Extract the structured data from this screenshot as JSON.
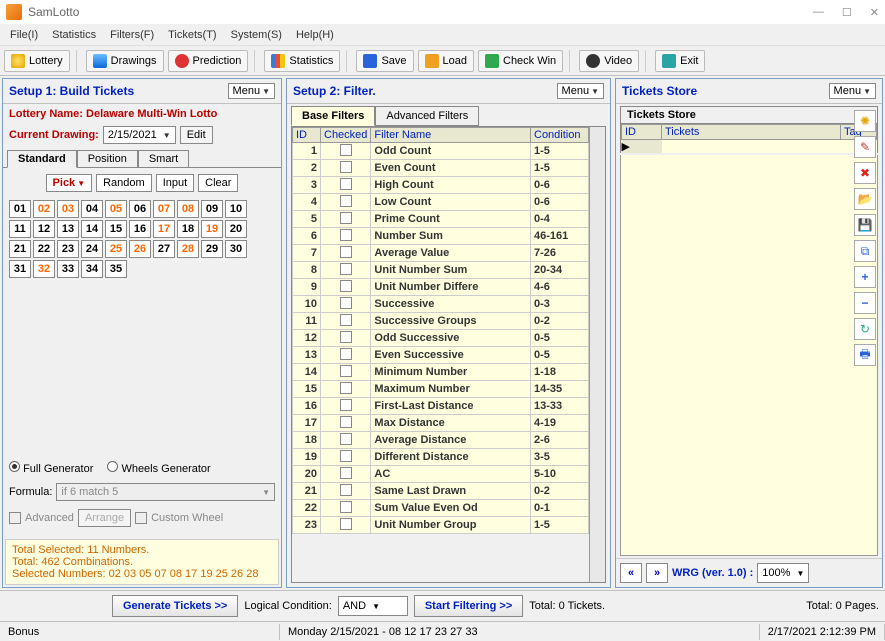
{
  "window": {
    "title": "SamLotto"
  },
  "menubar": [
    "File(I)",
    "Statistics",
    "Filters(F)",
    "Tickets(T)",
    "System(S)",
    "Help(H)"
  ],
  "toolbar": {
    "lottery": "Lottery",
    "drawings": "Drawings",
    "prediction": "Prediction",
    "statistics": "Statistics",
    "save": "Save",
    "load": "Load",
    "checkwin": "Check Win",
    "video": "Video",
    "exit": "Exit"
  },
  "p1": {
    "title": "Setup 1: Build  Tickets",
    "menu": "Menu",
    "lottery_label": "Lottery  Name: Delaware Multi-Win Lotto",
    "curdraw_label": "Current Drawing:",
    "curdraw_date": "2/15/2021",
    "edit": "Edit",
    "tabs": [
      "Standard",
      "Position",
      "Smart"
    ],
    "pick": "Pick",
    "random": "Random",
    "input": "Input",
    "clear": "Clear",
    "numbers": [
      {
        "n": "01",
        "s": false
      },
      {
        "n": "02",
        "s": true
      },
      {
        "n": "03",
        "s": true
      },
      {
        "n": "04",
        "s": false
      },
      {
        "n": "05",
        "s": true
      },
      {
        "n": "06",
        "s": false
      },
      {
        "n": "07",
        "s": true
      },
      {
        "n": "08",
        "s": true
      },
      {
        "n": "09",
        "s": false
      },
      {
        "n": "10",
        "s": false
      },
      {
        "n": "11",
        "s": false
      },
      {
        "n": "12",
        "s": false
      },
      {
        "n": "13",
        "s": false
      },
      {
        "n": "14",
        "s": false
      },
      {
        "n": "15",
        "s": false
      },
      {
        "n": "16",
        "s": false
      },
      {
        "n": "17",
        "s": true
      },
      {
        "n": "18",
        "s": false
      },
      {
        "n": "19",
        "s": true
      },
      {
        "n": "20",
        "s": false
      },
      {
        "n": "21",
        "s": false
      },
      {
        "n": "22",
        "s": false
      },
      {
        "n": "23",
        "s": false
      },
      {
        "n": "24",
        "s": false
      },
      {
        "n": "25",
        "s": true
      },
      {
        "n": "26",
        "s": true
      },
      {
        "n": "27",
        "s": false
      },
      {
        "n": "28",
        "s": true
      },
      {
        "n": "29",
        "s": false
      },
      {
        "n": "30",
        "s": false
      },
      {
        "n": "31",
        "s": false
      },
      {
        "n": "32",
        "s": true
      },
      {
        "n": "33",
        "s": false
      },
      {
        "n": "34",
        "s": false
      },
      {
        "n": "35",
        "s": false
      }
    ],
    "fullgen": "Full Generator",
    "wheelsgen": "Wheels Generator",
    "formula_label": "Formula:",
    "formula_value": "if 6 match 5",
    "advanced": "Advanced",
    "arrange": "Arrange",
    "customwheel": "Custom Wheel",
    "summary1": "Total Selected: 11 Numbers.",
    "summary2": "Total: 462 Combinations.",
    "summary3": "Selected Numbers: 02 03 05 07 08 17 19 25 26 28"
  },
  "p2": {
    "title": "Setup 2: Filter.",
    "menu": "Menu",
    "tabs": [
      "Base Filters",
      "Advanced Filters"
    ],
    "headers": {
      "id": "ID",
      "checked": "Checked",
      "filtername": "Filter Name",
      "condition": "Condition"
    },
    "rows": [
      {
        "id": "1",
        "name": "Odd Count",
        "cond": "1-5"
      },
      {
        "id": "2",
        "name": "Even Count",
        "cond": "1-5"
      },
      {
        "id": "3",
        "name": "High Count",
        "cond": "0-6"
      },
      {
        "id": "4",
        "name": "Low Count",
        "cond": "0-6"
      },
      {
        "id": "5",
        "name": "Prime Count",
        "cond": "0-4"
      },
      {
        "id": "6",
        "name": "Number Sum",
        "cond": "46-161"
      },
      {
        "id": "7",
        "name": "Average Value",
        "cond": "7-26"
      },
      {
        "id": "8",
        "name": "Unit Number Sum",
        "cond": "20-34"
      },
      {
        "id": "9",
        "name": "Unit Number Differe",
        "cond": "4-6"
      },
      {
        "id": "10",
        "name": "Successive",
        "cond": "0-3"
      },
      {
        "id": "11",
        "name": "Successive Groups",
        "cond": "0-2"
      },
      {
        "id": "12",
        "name": "Odd Successive",
        "cond": "0-5"
      },
      {
        "id": "13",
        "name": "Even Successive",
        "cond": "0-5"
      },
      {
        "id": "14",
        "name": "Minimum Number",
        "cond": "1-18"
      },
      {
        "id": "15",
        "name": "Maximum Number",
        "cond": "14-35"
      },
      {
        "id": "16",
        "name": "First-Last Distance",
        "cond": "13-33"
      },
      {
        "id": "17",
        "name": "Max Distance",
        "cond": "4-19"
      },
      {
        "id": "18",
        "name": "Average Distance",
        "cond": "2-6"
      },
      {
        "id": "19",
        "name": "Different Distance",
        "cond": "3-5"
      },
      {
        "id": "20",
        "name": "AC",
        "cond": "5-10"
      },
      {
        "id": "21",
        "name": "Same Last Drawn",
        "cond": "0-2"
      },
      {
        "id": "22",
        "name": "Sum Value Even Od",
        "cond": "0-1"
      },
      {
        "id": "23",
        "name": "Unit Number Group",
        "cond": "1-5"
      }
    ]
  },
  "p3": {
    "title": "Tickets Store",
    "menu": "Menu",
    "subtitle": "Tickets Store",
    "headers": {
      "id": "ID",
      "tickets": "Tickets",
      "tag": "Tag"
    },
    "wrg": "WRG (ver. 1.0) :",
    "zoom": "100%"
  },
  "bottom": {
    "gen": "Generate Tickets >>",
    "logical": "Logical Condition:",
    "and": "AND",
    "start": "Start Filtering >>",
    "total_tickets": "Total: 0 Tickets.",
    "total_pages": "Total: 0 Pages."
  },
  "status": {
    "left": "Bonus",
    "mid": "Monday 2/15/2021 - 08 12 17 23 27 33",
    "right": "2/17/2021 2:12:39 PM"
  }
}
